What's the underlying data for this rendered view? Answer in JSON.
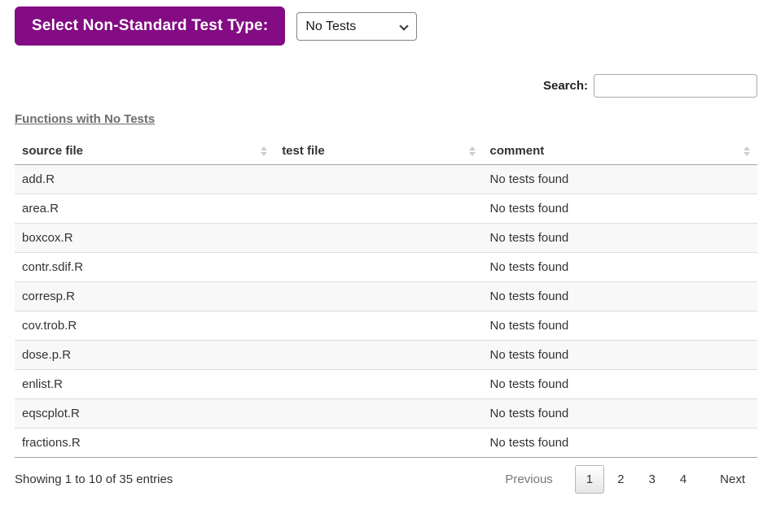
{
  "app": {
    "title_banner": "Select Non-Standard Test Type:",
    "accent_color": "#830b83"
  },
  "test_type_select": {
    "selected": "No Tests"
  },
  "search": {
    "label": "Search:",
    "value": ""
  },
  "section": {
    "link_label": "Functions with No Tests"
  },
  "table": {
    "columns": [
      "source file",
      "test file",
      "comment"
    ],
    "rows": [
      [
        "add.R",
        "",
        "No tests found"
      ],
      [
        "area.R",
        "",
        "No tests found"
      ],
      [
        "boxcox.R",
        "",
        "No tests found"
      ],
      [
        "contr.sdif.R",
        "",
        "No tests found"
      ],
      [
        "corresp.R",
        "",
        "No tests found"
      ],
      [
        "cov.trob.R",
        "",
        "No tests found"
      ],
      [
        "dose.p.R",
        "",
        "No tests found"
      ],
      [
        "enlist.R",
        "",
        "No tests found"
      ],
      [
        "eqscplot.R",
        "",
        "No tests found"
      ],
      [
        "fractions.R",
        "",
        "No tests found"
      ]
    ]
  },
  "footer": {
    "info": "Showing 1 to 10 of 35 entries",
    "pagination": {
      "previous_label": "Previous",
      "pages": [
        "1",
        "2",
        "3",
        "4"
      ],
      "current_page": "1",
      "next_label": "Next"
    }
  }
}
